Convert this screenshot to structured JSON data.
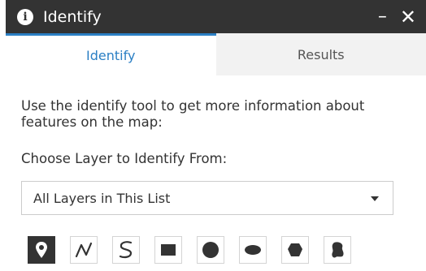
{
  "window": {
    "title": "Identify",
    "minimize": "–",
    "close": "✕"
  },
  "tabs": [
    {
      "label": "Identify",
      "active": true
    },
    {
      "label": "Results",
      "active": false
    }
  ],
  "panel": {
    "description": "Use the identify tool to get more information about features on the map:",
    "choose_label": "Choose Layer to Identify From:",
    "layer_select": {
      "value": "All Layers in This List"
    }
  },
  "tools": [
    {
      "name": "point-tool",
      "icon": "map-pin-icon",
      "active": true
    },
    {
      "name": "polyline-tool",
      "icon": "polyline-icon",
      "active": false
    },
    {
      "name": "freehand-line-tool",
      "icon": "freehand-line-icon",
      "active": false
    },
    {
      "name": "rectangle-tool",
      "icon": "rectangle-icon",
      "active": false
    },
    {
      "name": "circle-tool",
      "icon": "circle-icon",
      "active": false
    },
    {
      "name": "ellipse-tool",
      "icon": "ellipse-icon",
      "active": false
    },
    {
      "name": "polygon-tool",
      "icon": "polygon-icon",
      "active": false
    },
    {
      "name": "freehand-polygon-tool",
      "icon": "freehand-polygon-icon",
      "active": false
    }
  ],
  "colors": {
    "titlebar": "#333333",
    "accent": "#2b7fc4",
    "inactive_tab": "#f2f2f2"
  }
}
